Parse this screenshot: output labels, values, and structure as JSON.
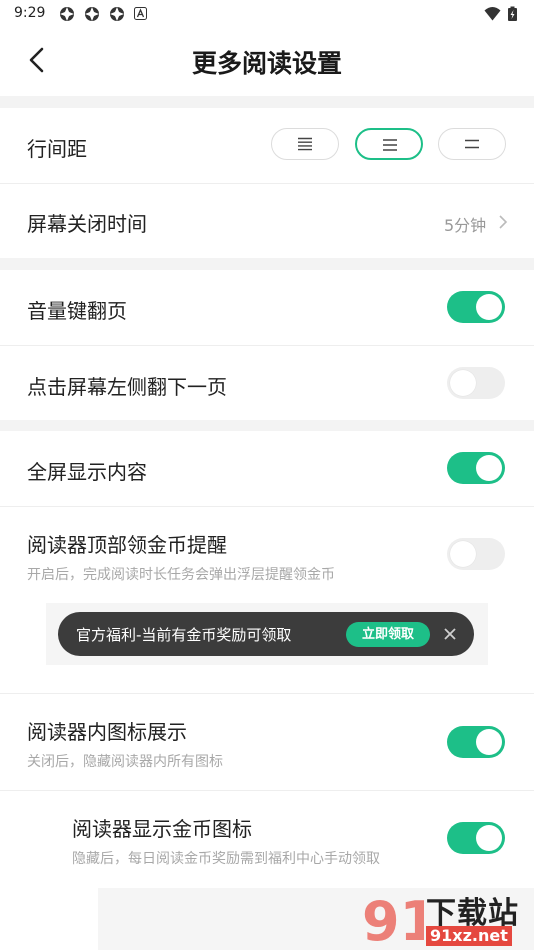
{
  "status_bar": {
    "time": "9:29"
  },
  "header": {
    "title": "更多阅读设置"
  },
  "line_spacing": {
    "label": "行间距",
    "options": [
      "large-spacing",
      "medium-spacing",
      "small-spacing"
    ],
    "selected_index": 1
  },
  "screen_off": {
    "label": "屏幕关闭时间",
    "value": "5分钟"
  },
  "volume_key": {
    "label": "音量键翻页",
    "enabled": true
  },
  "tap_left": {
    "label": "点击屏幕左侧翻下一页",
    "enabled": false
  },
  "fullscreen": {
    "label": "全屏显示内容",
    "enabled": true
  },
  "coin_reminder": {
    "label": "阅读器顶部领金币提醒",
    "description": "开启后，完成阅读时长任务会弹出浮层提醒领金币",
    "enabled": false,
    "preview": {
      "text": "官方福利-当前有金币奖励可领取",
      "button": "立即领取"
    }
  },
  "icon_display": {
    "label": "阅读器内图标展示",
    "description": "关闭后，隐藏阅读器内所有图标",
    "enabled": true
  },
  "coin_icon": {
    "label": "阅读器显示金币图标",
    "description": "隐藏后，每日阅读金币奖励需到福利中心手动领取",
    "enabled": true
  },
  "colors": {
    "accent": "#1dbf88",
    "toggle_off": "#eeeeee",
    "section_gap": "#f3f3f3",
    "toast_bg": "#3c3c3c"
  },
  "watermark": {
    "text": "下载站",
    "url": "91xz.net"
  }
}
